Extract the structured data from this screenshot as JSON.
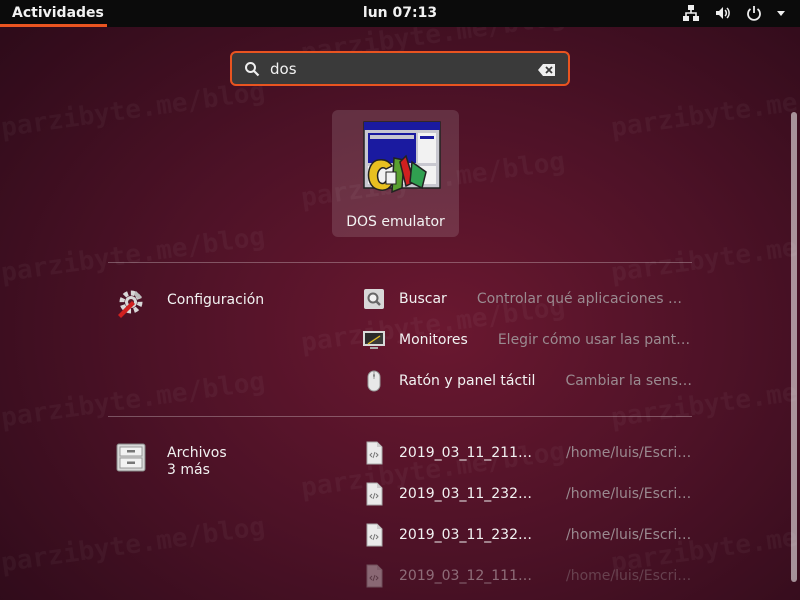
{
  "topbar": {
    "activities_label": "Actividades",
    "clock": "lun 07:13",
    "tray_icons": [
      "network-wired-icon",
      "volume-icon",
      "power-icon",
      "chevron-down-icon"
    ]
  },
  "search": {
    "value": "dos",
    "icon": "search-icon",
    "clear_icon": "backspace-clear-icon"
  },
  "app_result": {
    "label": "DOS emulator",
    "icon": "dos-emulator-icon"
  },
  "settings_provider": {
    "name": "Configuración",
    "icon": "settings-tools-icon",
    "results": [
      {
        "name": "Buscar",
        "description": "Controlar qué aplicaciones muestran resultados de búsqueda",
        "icon": "search-settings-icon"
      },
      {
        "name": "Monitores",
        "description": "Elegir cómo usar las pantallas",
        "icon": "display-icon"
      },
      {
        "name": "Ratón y panel táctil",
        "description": "Cambiar la sensibilidad del ratón",
        "icon": "mouse-icon"
      }
    ]
  },
  "files_provider": {
    "name": "Archivos",
    "more": "3 más",
    "icon": "file-cabinet-icon",
    "results": [
      {
        "name": "2019_03_11_211…",
        "path": "/home/luis/Escritorio",
        "icon": "html-file-icon"
      },
      {
        "name": "2019_03_11_232…",
        "path": "/home/luis/Escritorio",
        "icon": "html-file-icon"
      },
      {
        "name": "2019_03_11_232…",
        "path": "/home/luis/Escritorio",
        "icon": "html-file-icon"
      },
      {
        "name": "2019_03_12_111…",
        "path": "/home/luis/Escritorio",
        "icon": "html-file-icon"
      }
    ]
  },
  "watermark_text": "parzibyte.me/blog",
  "colors": {
    "accent": "#e95420",
    "topbar": "#0b0b0b",
    "muted_text": "#9a8a90"
  }
}
